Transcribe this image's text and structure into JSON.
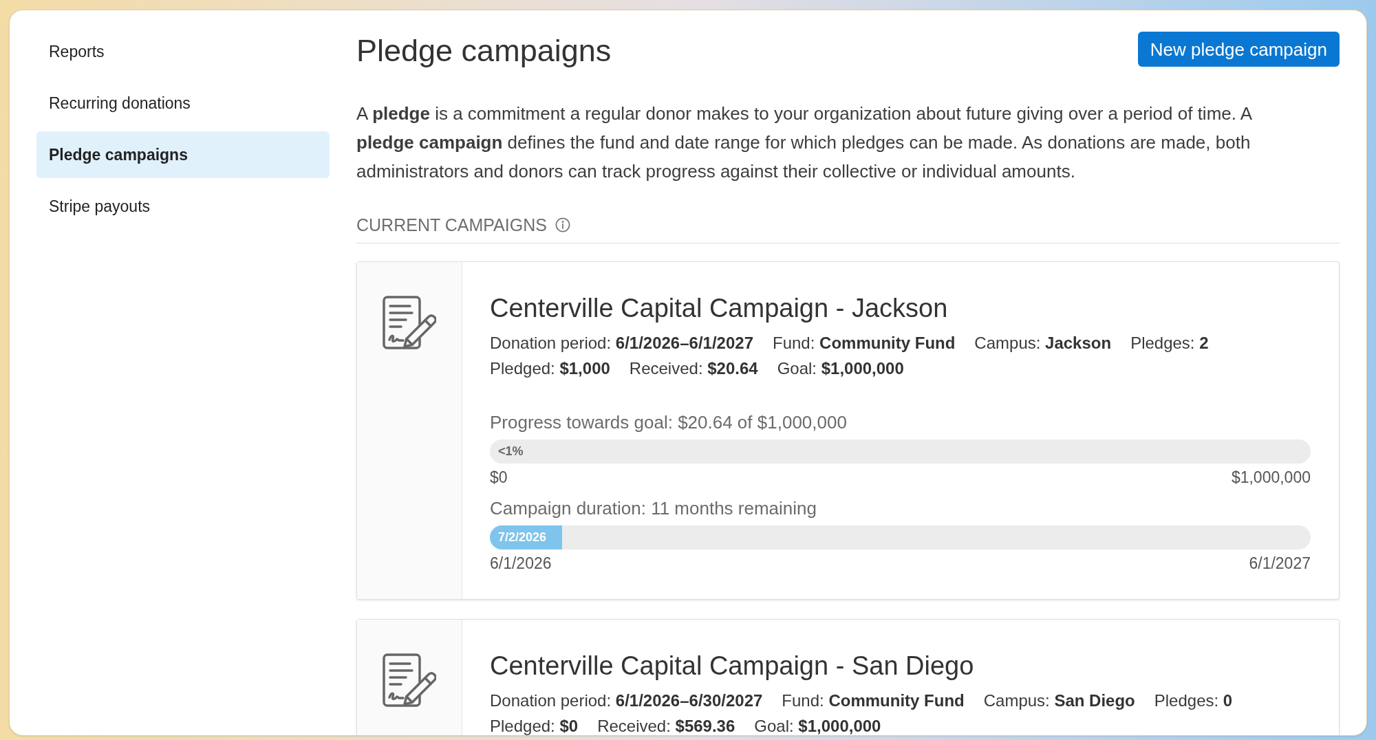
{
  "sidebar": {
    "items": [
      {
        "label": "Reports",
        "selected": false
      },
      {
        "label": "Recurring donations",
        "selected": false
      },
      {
        "label": "Pledge campaigns",
        "selected": true
      },
      {
        "label": "Stripe payouts",
        "selected": false
      }
    ]
  },
  "header": {
    "title": "Pledge campaigns",
    "primary_button": "New pledge campaign"
  },
  "description": "A **pledge** is a commitment a regular donor makes to your organization about future giving over a period of time. A **pledge campaign** defines the fund and date range for which pledges can be made. As donations are made, both administrators and donors can track progress against their collective or individual amounts.",
  "section": {
    "title": "CURRENT CAMPAIGNS"
  },
  "campaigns": [
    {
      "title": "Centerville Capital Campaign - Jackson",
      "detail_lines": [
        {
          "fields": [
            {
              "label": "Donation period:",
              "value": "6/1/2026–6/1/2027"
            },
            {
              "label": "Fund:",
              "value": "Community Fund"
            },
            {
              "label": "Campus:",
              "value": "Jackson"
            },
            {
              "label": "Pledges:",
              "value": "2"
            }
          ]
        },
        {
          "fields": [
            {
              "label": "Pledged:",
              "value": "$1,000"
            },
            {
              "label": "Received:",
              "value": "$20.64"
            },
            {
              "label": "Goal:",
              "value": "$1,000,000"
            }
          ]
        }
      ],
      "progress": [
        {
          "caption": "Progress towards goal: $20.64 of $1,000,000",
          "bar_label": "<1%",
          "level": 2e-05,
          "start": "$0",
          "end": "$1,000,000"
        },
        {
          "caption": "Campaign duration: 11 months remaining",
          "bar_label": "7/2/2026",
          "level": 0.088,
          "start": "6/1/2026",
          "end": "6/1/2027"
        }
      ]
    },
    {
      "title": "Centerville Capital Campaign - San Diego",
      "detail_lines": [
        {
          "fields": [
            {
              "label": "Donation period:",
              "value": "6/1/2026–6/30/2027"
            },
            {
              "label": "Fund:",
              "value": "Community Fund"
            },
            {
              "label": "Campus:",
              "value": "San Diego"
            },
            {
              "label": "Pledges:",
              "value": "0"
            }
          ]
        },
        {
          "fields": [
            {
              "label": "Pledged:",
              "value": "$0"
            },
            {
              "label": "Received:",
              "value": "$569.36"
            },
            {
              "label": "Goal:",
              "value": "$1,000,000"
            }
          ]
        }
      ]
    }
  ]
}
